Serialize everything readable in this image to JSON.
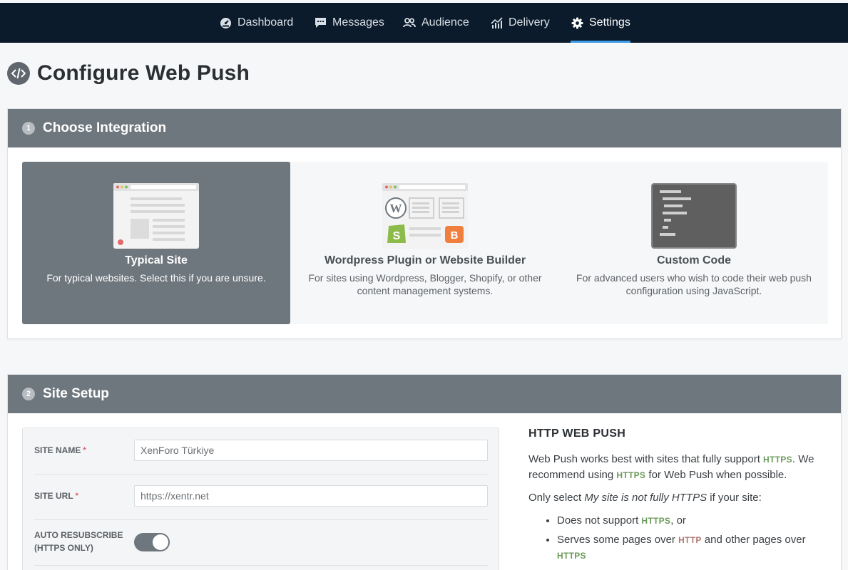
{
  "nav": {
    "items": [
      {
        "label": "Dashboard",
        "icon": "dashboard-icon"
      },
      {
        "label": "Messages",
        "icon": "messages-icon"
      },
      {
        "label": "Audience",
        "icon": "audience-icon"
      },
      {
        "label": "Delivery",
        "icon": "delivery-icon"
      },
      {
        "label": "Settings",
        "icon": "gear-icon",
        "active": true
      }
    ]
  },
  "page": {
    "title": "Configure Web Push",
    "icon": "code-icon"
  },
  "integration": {
    "step": "1",
    "title": "Choose Integration",
    "options": [
      {
        "title": "Typical Site",
        "desc": "For typical websites. Select this if you are unsure.",
        "selected": true
      },
      {
        "title": "Wordpress Plugin or Website Builder",
        "desc": "For sites using Wordpress, Blogger, Shopify, or other content management systems.",
        "selected": false
      },
      {
        "title": "Custom Code",
        "desc": "For advanced users who wish to code their web push configuration using JavaScript.",
        "selected": false
      }
    ]
  },
  "setup": {
    "step": "2",
    "title": "Site Setup",
    "fields": {
      "site_name_label": "SITE NAME",
      "site_name_value": "XenForo Türkiye",
      "site_url_label": "SITE URL",
      "site_url_value": "https://xentr.net",
      "auto_resub_label_1": "AUTO RESUBSCRIBE",
      "auto_resub_label_2": "(HTTPS ONLY)",
      "auto_resub_on": true,
      "required_mark": "*"
    },
    "help": {
      "title": "HTTP WEB PUSH",
      "p1_a": "Web Push works best with sites that fully support ",
      "https": "HTTPS",
      "http": "HTTP",
      "p1_b": ". We recommend using ",
      "p1_c": " for Web Push when possible.",
      "p2_a": "Only select ",
      "p2_em": "My site is not fully HTTPS",
      "p2_b": " if your site:",
      "li1_a": "Does not support ",
      "li1_b": ", or",
      "li2_a": "Serves some pages over ",
      "li2_b": " and other pages over "
    }
  },
  "colors": {
    "nav_bg": "#0b1b2b",
    "accent": "#3b9be8",
    "header_bg": "#6f777e",
    "https_green": "#6a9a5a",
    "http_red": "#b07c74"
  }
}
